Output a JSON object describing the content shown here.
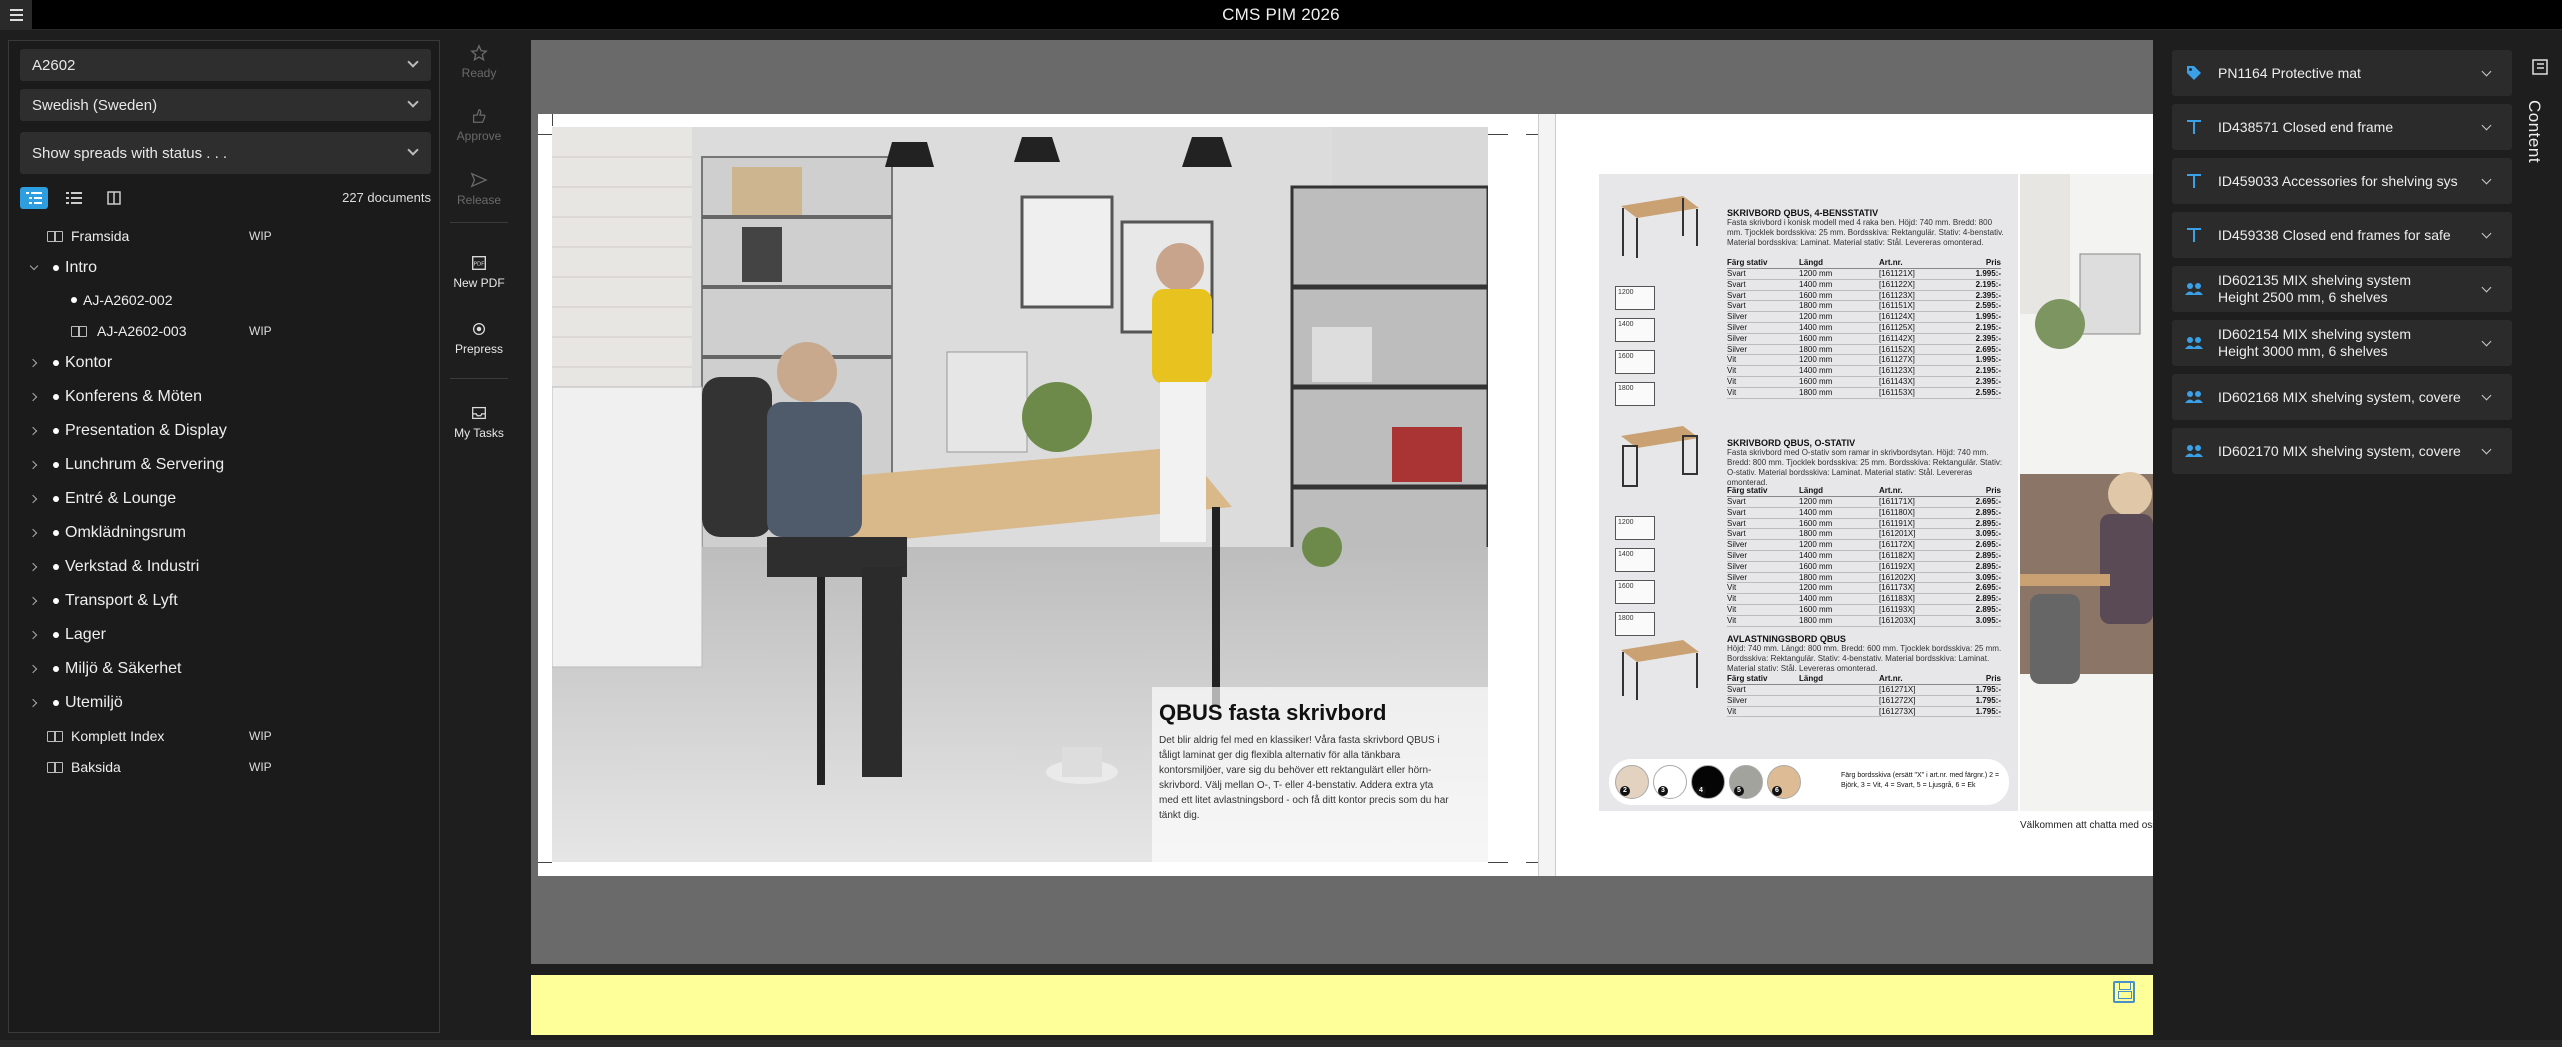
{
  "app": {
    "title": "CMS PIM 2026"
  },
  "left": {
    "publication": "A2602",
    "language": "Swedish (Sweden)",
    "status_filter": "Show spreads with status . . .",
    "doc_count": "227 documents",
    "tree": [
      {
        "label": "Framsida",
        "kind": "page",
        "wip": "WIP"
      },
      {
        "label": "Intro",
        "kind": "section",
        "expanded": true
      },
      {
        "label": "AJ-A2602-002",
        "kind": "subsection"
      },
      {
        "label": "AJ-A2602-003",
        "kind": "page-sub",
        "wip": "WIP"
      },
      {
        "label": "Kontor",
        "kind": "section"
      },
      {
        "label": "Konferens & Möten",
        "kind": "section"
      },
      {
        "label": "Presentation & Display",
        "kind": "section"
      },
      {
        "label": "Lunchrum & Servering",
        "kind": "section"
      },
      {
        "label": "Entré & Lounge",
        "kind": "section"
      },
      {
        "label": "Omklädningsrum",
        "kind": "section"
      },
      {
        "label": "Verkstad & Industri",
        "kind": "section"
      },
      {
        "label": "Transport & Lyft",
        "kind": "section"
      },
      {
        "label": "Lager",
        "kind": "section"
      },
      {
        "label": "Miljö & Säkerhet",
        "kind": "section"
      },
      {
        "label": "Utemiljö",
        "kind": "section"
      },
      {
        "label": "Komplett Index",
        "kind": "page",
        "wip": "WIP"
      },
      {
        "label": "Baksida",
        "kind": "page",
        "wip": "WIP"
      }
    ]
  },
  "tools": {
    "ready": "Ready",
    "approve": "Approve",
    "release": "Release",
    "new_pdf": "New PDF",
    "prepress": "Prepress",
    "my_tasks": "My Tasks"
  },
  "spread": {
    "headline": "QBUS fasta skrivbord",
    "body": "Det blir aldrig fel med en klassiker! Våra fasta skrivbord QBUS i tåligt laminat ger dig flexibla alternativ för alla tänkbara kontorsmiljöer, vare sig du behöver ett rektangulärt eller hörn-skrivbord. Välj mellan O-, T- eller 4-benstativ. Addera extra yta med ett litet avlastningsbord - och få ditt kontor precis som du har tänkt dig.",
    "chat": "Välkommen att chatta med oss",
    "catalog": {
      "headers": {
        "color": "Färg stativ",
        "length": "Längd",
        "art": "Art.nr.",
        "price": "Pris"
      },
      "blocks": [
        {
          "title": "SKRIVBORD QBUS, 4-BENSSTATIV",
          "desc": "Fasta skrivbord i konisk modell med 4 raka ben. Höjd: 740 mm. Bredd: 800 mm. Tjocklek bordsskiva: 25 mm. Bordsskiva: Rektangulär. Stativ: 4-benstativ. Material bordsskiva: Laminat. Material stativ: Stål. Levereras omonterad.",
          "sizes": [
            "1200",
            "1400",
            "1600",
            "1800"
          ],
          "rows": [
            [
              "Svart",
              "1200 mm",
              "[161121X]",
              "1.995:-"
            ],
            [
              "Svart",
              "1400 mm",
              "[161122X]",
              "2.195:-"
            ],
            [
              "Svart",
              "1600 mm",
              "[161123X]",
              "2.395:-"
            ],
            [
              "Svart",
              "1800 mm",
              "[161151X]",
              "2.595:-"
            ],
            [
              "Silver",
              "1200 mm",
              "[161124X]",
              "1.995:-"
            ],
            [
              "Silver",
              "1400 mm",
              "[161125X]",
              "2.195:-"
            ],
            [
              "Silver",
              "1600 mm",
              "[161142X]",
              "2.395:-"
            ],
            [
              "Silver",
              "1800 mm",
              "[161152X]",
              "2.695:-"
            ],
            [
              "Vit",
              "1200 mm",
              "[161127X]",
              "1.995:-"
            ],
            [
              "Vit",
              "1400 mm",
              "[161123X]",
              "2.195:-"
            ],
            [
              "Vit",
              "1600 mm",
              "[161143X]",
              "2.395:-"
            ],
            [
              "Vit",
              "1800 mm",
              "[161153X]",
              "2.595:-"
            ]
          ]
        },
        {
          "title": "SKRIVBORD QBUS, O-STATIV",
          "desc": "Fasta skrivbord med O-stativ som ramar in skrivbordsytan. Höjd: 740 mm. Bredd: 800 mm. Tjocklek bordsskiva: 25 mm. Bordsskiva: Rektangulär. Stativ: O-stativ. Material bordsskiva: Laminat. Material stativ: Stål. Levereras omonterad.",
          "sizes": [
            "1200",
            "1400",
            "1600",
            "1800"
          ],
          "rows": [
            [
              "Svart",
              "1200 mm",
              "[161171X]",
              "2.695:-"
            ],
            [
              "Svart",
              "1400 mm",
              "[161180X]",
              "2.895:-"
            ],
            [
              "Svart",
              "1600 mm",
              "[161191X]",
              "2.895:-"
            ],
            [
              "Svart",
              "1800 mm",
              "[161201X]",
              "3.095:-"
            ],
            [
              "Silver",
              "1200 mm",
              "[161172X]",
              "2.695:-"
            ],
            [
              "Silver",
              "1400 mm",
              "[161182X]",
              "2.895:-"
            ],
            [
              "Silver",
              "1600 mm",
              "[161192X]",
              "2.895:-"
            ],
            [
              "Silver",
              "1800 mm",
              "[161202X]",
              "3.095:-"
            ],
            [
              "Vit",
              "1200 mm",
              "[161173X]",
              "2.695:-"
            ],
            [
              "Vit",
              "1400 mm",
              "[161183X]",
              "2.895:-"
            ],
            [
              "Vit",
              "1600 mm",
              "[161193X]",
              "2.895:-"
            ],
            [
              "Vit",
              "1800 mm",
              "[161203X]",
              "3.095:-"
            ]
          ]
        },
        {
          "title": "AVLASTNINGSBORD QBUS",
          "desc": "Höjd: 740 mm. Längd: 800 mm. Bredd: 600 mm. Tjocklek bordsskiva: 25 mm. Bordsskiva: Rektangulär. Stativ: 4-benstativ. Material bordsskiva: Laminat. Material stativ: Stål. Levereras omonterad.",
          "sizes": [],
          "rows": [
            [
              "Svart",
              "",
              "[161271X]",
              "1.795:-"
            ],
            [
              "Silver",
              "",
              "[161272X]",
              "1.795:-"
            ],
            [
              "Vit",
              "",
              "[161273X]",
              "1.795:-"
            ]
          ]
        }
      ],
      "swatch_note": "Färg bordsskiva (ersätt \"X\" i art.nr. med färgnr.) 2 = Björk, 3 = Vit, 4 = Svart, 5 = Ljusgrå, 6 = Ek",
      "swatch_numbers": [
        "2",
        "3",
        "4",
        "5",
        "6"
      ],
      "swatch_colors": [
        "#e3d2bf",
        "#ffffff",
        "#050505",
        "#a3a39e",
        "#dcbb95"
      ]
    }
  },
  "right": {
    "items": [
      {
        "label": "PN1164 Protective mat",
        "icon": "tag-icon"
      },
      {
        "label": "ID438571 Closed end frame",
        "icon": "text-icon"
      },
      {
        "label": "ID459033 Accessories for shelving sys",
        "icon": "text-icon"
      },
      {
        "label": "ID459338 Closed end frames for safe",
        "icon": "text-icon"
      },
      {
        "label": "ID602135 MIX shelving system",
        "label2": "Height 2500 mm, 6 shelves",
        "icon": "group-icon"
      },
      {
        "label": "ID602154 MIX shelving system",
        "label2": "Height 3000 mm, 6 shelves",
        "icon": "group-icon"
      },
      {
        "label": "ID602168 MIX shelving system, covere",
        "icon": "group-icon"
      },
      {
        "label": "ID602170 MIX shelving system, covere",
        "icon": "group-icon"
      }
    ],
    "side_tab": "Content"
  },
  "colors": {
    "accent": "#2d9ee0",
    "yellow_bar": "#ffff99",
    "icon_blue": "#3aa0e8"
  }
}
